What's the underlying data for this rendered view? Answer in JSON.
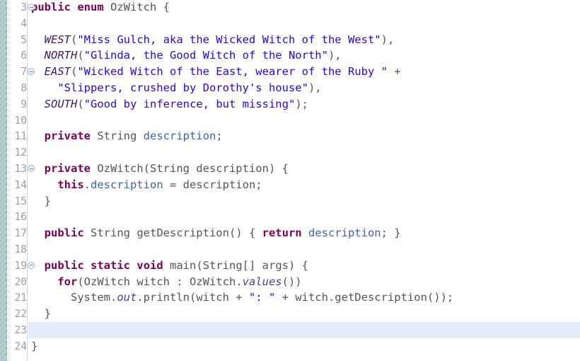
{
  "editor": {
    "language": "Java",
    "font_family_style": "monospace",
    "colors": {
      "background": "#ffffff",
      "keyword": "#7f0055",
      "string": "#2a00ff",
      "enum_constant": "#3b1a6e",
      "field": "#3f5fbf",
      "static_member": "#3f3f9f",
      "plain_text": "#555555",
      "line_number": "#a0a0a0",
      "current_line_highlight": "#e3ebfb",
      "annotation_strip": "#4a90d9",
      "gutter_separator": "#d4d4d4",
      "fold_marker_border": "#9fb6cd"
    },
    "current_line": 23,
    "first_visible_line": 3,
    "last_visible_line": 24,
    "fold_marker_lines": [
      7,
      13,
      19
    ]
  },
  "lines": [
    {
      "number": "3",
      "fold": true,
      "folded_state": "none",
      "tokens": [
        {
          "t": "public",
          "c": "tok-keyword"
        },
        {
          "t": " ",
          "c": "tok-plain"
        },
        {
          "t": "enum",
          "c": "tok-keyword"
        },
        {
          "t": " OzWitch {",
          "c": "tok-plain"
        }
      ]
    },
    {
      "number": "4",
      "fold": false,
      "tokens": []
    },
    {
      "number": "5",
      "fold": false,
      "tokens": [
        {
          "t": "  ",
          "c": "tok-plain"
        },
        {
          "t": "WEST",
          "c": "tok-enumconst"
        },
        {
          "t": "(",
          "c": "tok-plain"
        },
        {
          "t": "\"Miss Gulch, aka the Wicked Witch of the West\"",
          "c": "tok-string"
        },
        {
          "t": "),",
          "c": "tok-plain"
        }
      ]
    },
    {
      "number": "6",
      "fold": false,
      "tokens": [
        {
          "t": "  ",
          "c": "tok-plain"
        },
        {
          "t": "NORTH",
          "c": "tok-enumconst"
        },
        {
          "t": "(",
          "c": "tok-plain"
        },
        {
          "t": "\"Glinda, the Good Witch of the North\"",
          "c": "tok-string"
        },
        {
          "t": "),",
          "c": "tok-plain"
        }
      ]
    },
    {
      "number": "7",
      "fold": true,
      "tokens": [
        {
          "t": "  ",
          "c": "tok-plain"
        },
        {
          "t": "EAST",
          "c": "tok-enumconst"
        },
        {
          "t": "(",
          "c": "tok-plain"
        },
        {
          "t": "\"Wicked Witch of the East, wearer of the Ruby \"",
          "c": "tok-string"
        },
        {
          "t": " +",
          "c": "tok-plain"
        }
      ]
    },
    {
      "number": "8",
      "fold": false,
      "tokens": [
        {
          "t": "    ",
          "c": "tok-plain"
        },
        {
          "t": "\"Slippers, crushed by Dorothy's house\"",
          "c": "tok-string"
        },
        {
          "t": "),",
          "c": "tok-plain"
        }
      ]
    },
    {
      "number": "9",
      "fold": false,
      "tokens": [
        {
          "t": "  ",
          "c": "tok-plain"
        },
        {
          "t": "SOUTH",
          "c": "tok-enumconst"
        },
        {
          "t": "(",
          "c": "tok-plain"
        },
        {
          "t": "\"Good by inference, but missing\"",
          "c": "tok-string"
        },
        {
          "t": ");",
          "c": "tok-plain"
        }
      ]
    },
    {
      "number": "10",
      "fold": false,
      "tokens": []
    },
    {
      "number": "11",
      "fold": false,
      "tokens": [
        {
          "t": "  ",
          "c": "tok-plain"
        },
        {
          "t": "private",
          "c": "tok-keyword"
        },
        {
          "t": " String ",
          "c": "tok-plain"
        },
        {
          "t": "description",
          "c": "tok-field"
        },
        {
          "t": ";",
          "c": "tok-plain"
        }
      ]
    },
    {
      "number": "12",
      "fold": false,
      "tokens": []
    },
    {
      "number": "13",
      "fold": true,
      "tokens": [
        {
          "t": "  ",
          "c": "tok-plain"
        },
        {
          "t": "private",
          "c": "tok-keyword"
        },
        {
          "t": " OzWitch(String description) {",
          "c": "tok-plain"
        }
      ]
    },
    {
      "number": "14",
      "fold": false,
      "tokens": [
        {
          "t": "    ",
          "c": "tok-plain"
        },
        {
          "t": "this",
          "c": "tok-keyword"
        },
        {
          "t": ".",
          "c": "tok-plain"
        },
        {
          "t": "description",
          "c": "tok-field"
        },
        {
          "t": " = description;",
          "c": "tok-plain"
        }
      ]
    },
    {
      "number": "15",
      "fold": false,
      "tokens": [
        {
          "t": "  }",
          "c": "tok-plain"
        }
      ]
    },
    {
      "number": "16",
      "fold": false,
      "tokens": []
    },
    {
      "number": "17",
      "fold": false,
      "tokens": [
        {
          "t": "  ",
          "c": "tok-plain"
        },
        {
          "t": "public",
          "c": "tok-keyword"
        },
        {
          "t": " String getDescription() { ",
          "c": "tok-plain"
        },
        {
          "t": "return",
          "c": "tok-keyword"
        },
        {
          "t": " ",
          "c": "tok-plain"
        },
        {
          "t": "description",
          "c": "tok-field"
        },
        {
          "t": "; }",
          "c": "tok-plain"
        }
      ]
    },
    {
      "number": "18",
      "fold": false,
      "tokens": []
    },
    {
      "number": "19",
      "fold": true,
      "tokens": [
        {
          "t": "  ",
          "c": "tok-plain"
        },
        {
          "t": "public",
          "c": "tok-keyword"
        },
        {
          "t": " ",
          "c": "tok-plain"
        },
        {
          "t": "static",
          "c": "tok-keyword"
        },
        {
          "t": " ",
          "c": "tok-plain"
        },
        {
          "t": "void",
          "c": "tok-keyword"
        },
        {
          "t": " main(String[] args) {",
          "c": "tok-plain"
        }
      ]
    },
    {
      "number": "20",
      "fold": false,
      "tokens": [
        {
          "t": "    ",
          "c": "tok-plain"
        },
        {
          "t": "for",
          "c": "tok-keyword"
        },
        {
          "t": "(OzWitch witch : OzWitch.",
          "c": "tok-plain"
        },
        {
          "t": "values",
          "c": "tok-static"
        },
        {
          "t": "())",
          "c": "tok-plain"
        }
      ]
    },
    {
      "number": "21",
      "fold": false,
      "tokens": [
        {
          "t": "      System.",
          "c": "tok-plain"
        },
        {
          "t": "out",
          "c": "tok-static"
        },
        {
          "t": ".println(witch + ",
          "c": "tok-plain"
        },
        {
          "t": "\": \"",
          "c": "tok-string"
        },
        {
          "t": " + witch.getDescription());",
          "c": "tok-plain"
        }
      ]
    },
    {
      "number": "22",
      "fold": false,
      "tokens": [
        {
          "t": "  }",
          "c": "tok-plain"
        }
      ]
    },
    {
      "number": "23",
      "fold": false,
      "tokens": []
    },
    {
      "number": "24",
      "fold": false,
      "tokens": [
        {
          "t": "}",
          "c": "tok-plain"
        }
      ]
    }
  ]
}
